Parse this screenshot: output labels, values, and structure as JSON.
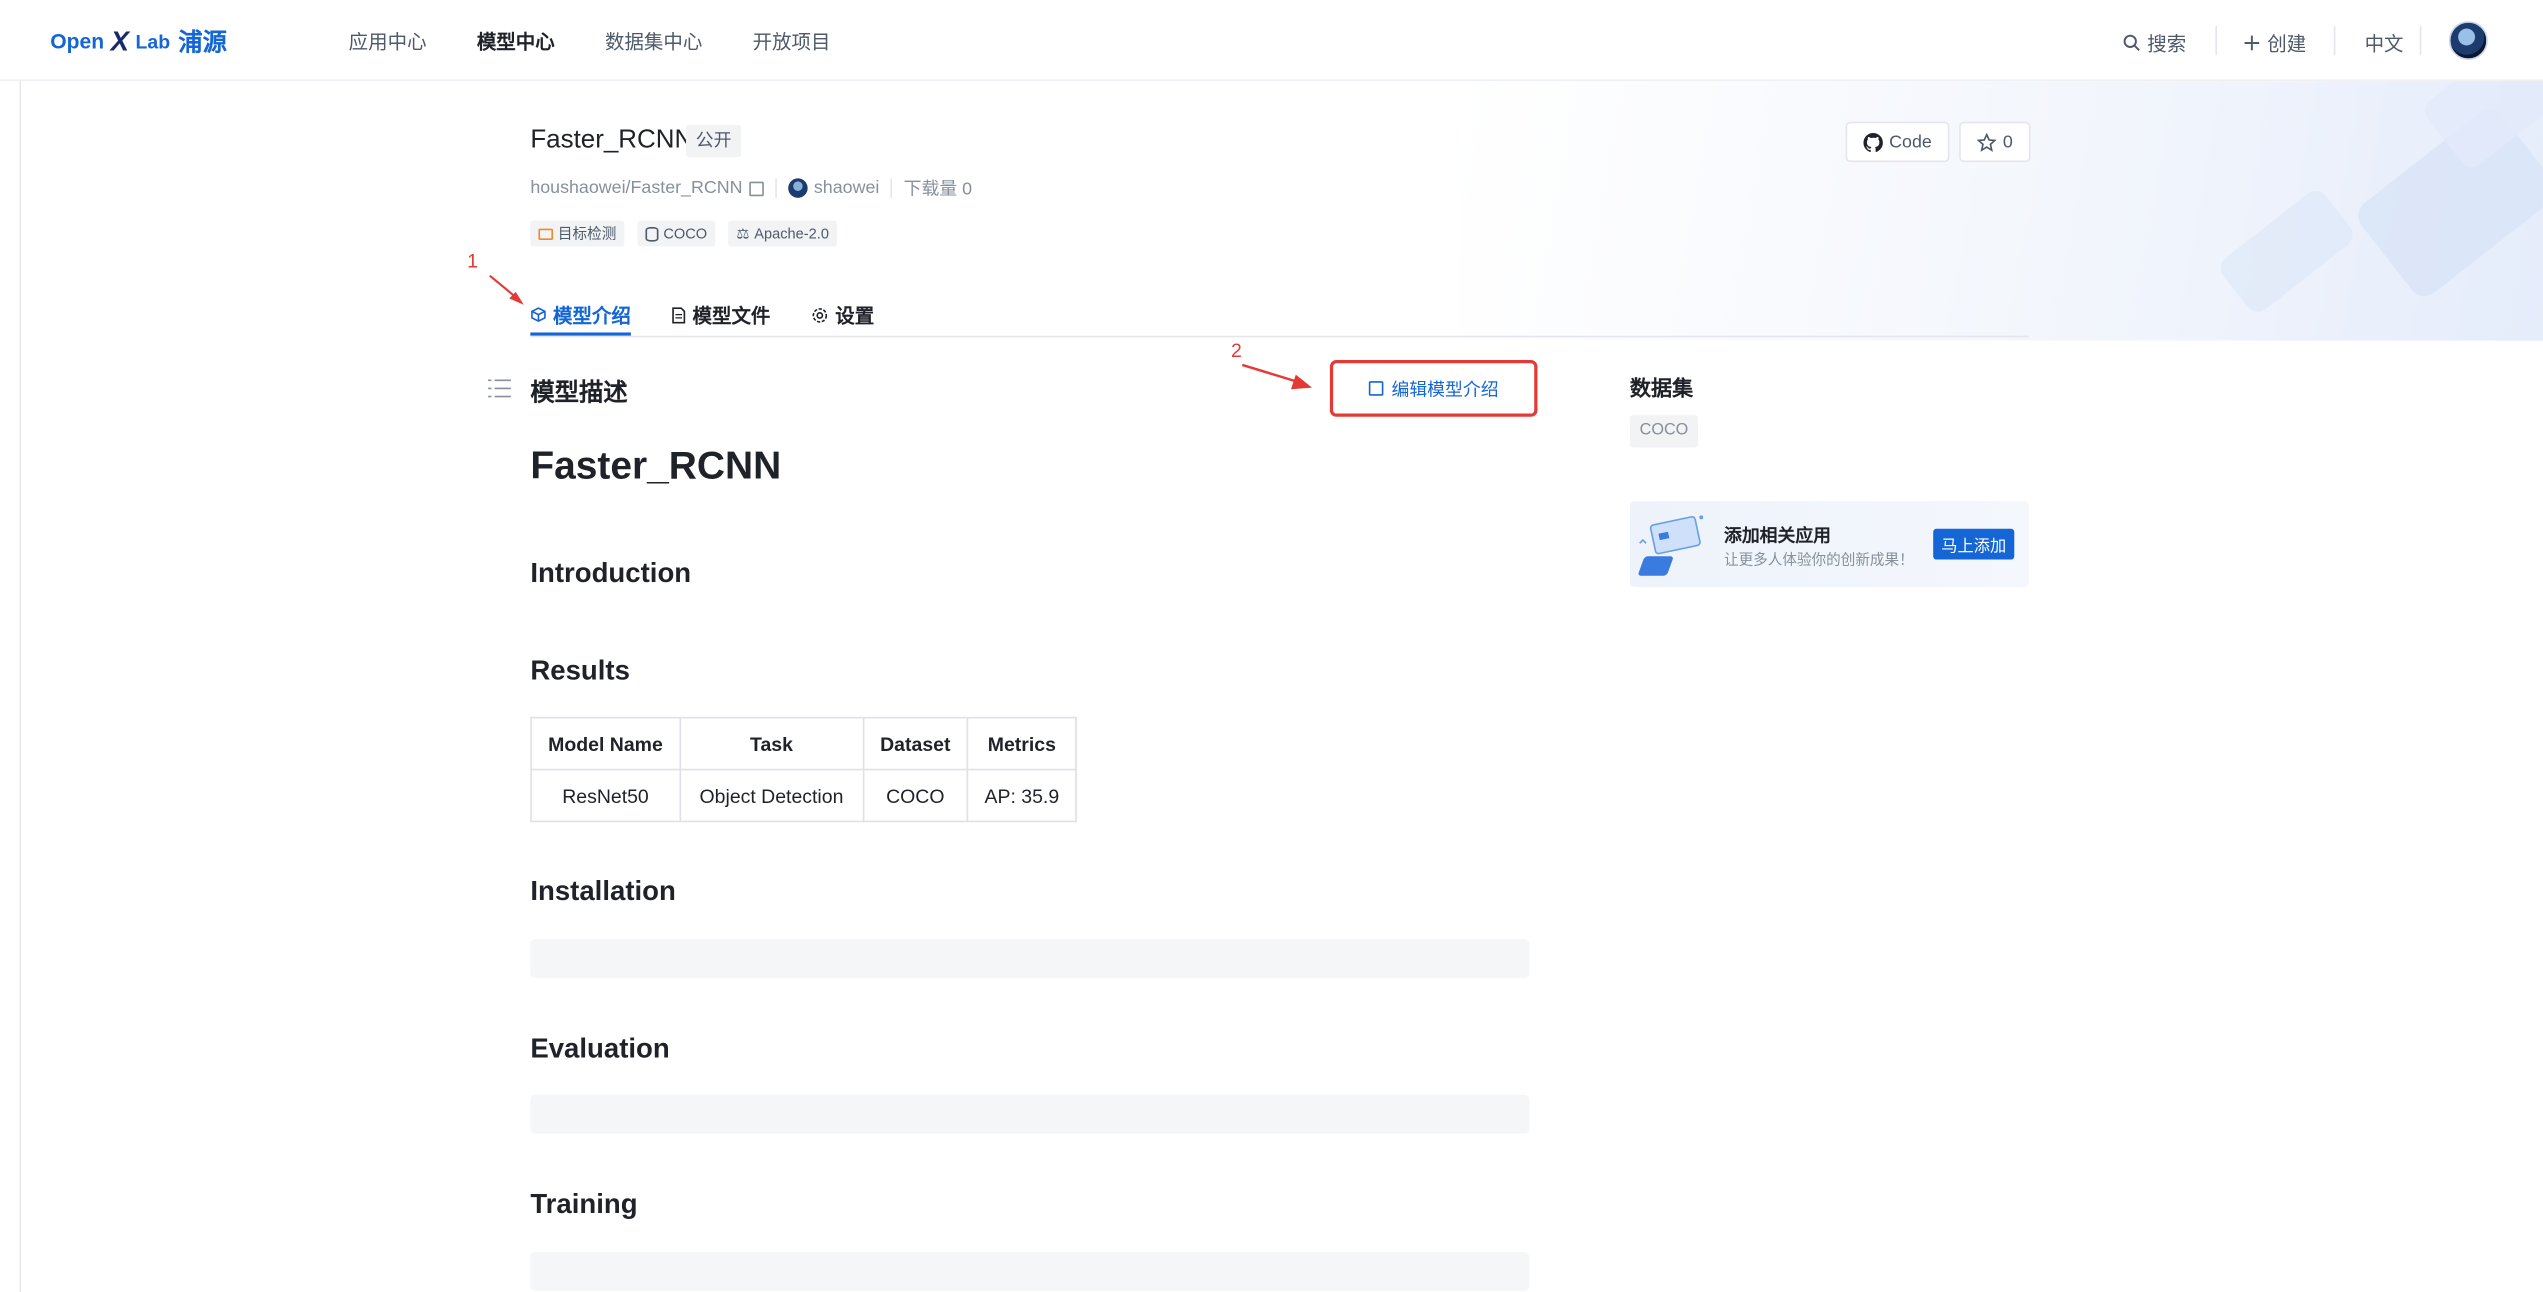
{
  "header": {
    "logo": {
      "open": "Open",
      "x": "X",
      "lab": "Lab",
      "cn": "浦源"
    },
    "nav": [
      "应用中心",
      "模型中心",
      "数据集中心",
      "开放项目"
    ],
    "active_nav": "模型中心",
    "search_label": "搜索",
    "create_label": "创建",
    "language_label": "中文"
  },
  "model": {
    "name": "Faster_RCNN",
    "visibility": "公开",
    "path": "houshaowei/Faster_RCNN",
    "author": "shaowei",
    "downloads": "下载量 0",
    "tags": [
      "目标检测",
      "COCO",
      "Apache-2.0"
    ],
    "code_label": "Code",
    "star_count": "0"
  },
  "tabs": [
    "模型介绍",
    "模型文件",
    "设置"
  ],
  "annotations": {
    "one": "1",
    "two": "2"
  },
  "content": {
    "section_title": "模型描述",
    "edit_label": "编辑模型介绍",
    "h1": "Faster_RCNN",
    "headings": [
      "Introduction",
      "Results",
      "Installation",
      "Evaluation",
      "Training"
    ],
    "table": {
      "headers": [
        "Model Name",
        "Task",
        "Dataset",
        "Metrics"
      ],
      "rows": [
        [
          "ResNet50",
          "Object Detection",
          "COCO",
          "AP: 35.9"
        ]
      ]
    }
  },
  "sidebar": {
    "dataset_title": "数据集",
    "dataset_tag": "COCO",
    "promo_title": "添加相关应用",
    "promo_sub": "让更多人体验你的创新成果！",
    "promo_button": "马上添加"
  },
  "colors": {
    "accent": "#1465d6",
    "annotation": "#e53935"
  }
}
